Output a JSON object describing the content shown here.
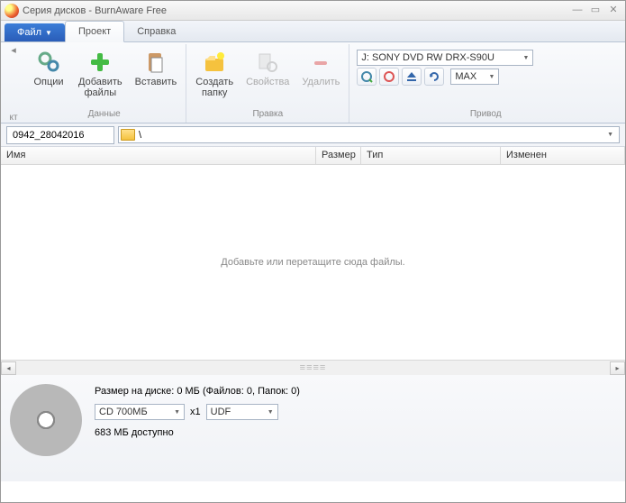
{
  "window": {
    "title": "Серия дисков - BurnAware Free"
  },
  "tabs": {
    "file": "Файл",
    "project": "Проект",
    "help": "Справка"
  },
  "ribbon": {
    "nav_label": "кт",
    "options": "Опции",
    "add_files": "Добавить\nфайлы",
    "paste": "Вставить",
    "create_folder": "Создать\nпапку",
    "properties": "Свойства",
    "delete": "Удалить",
    "group_data": "Данные",
    "group_edit": "Правка",
    "group_drive": "Привод",
    "drive": "J: SONY DVD RW DRX-S90U",
    "speed": "MAX"
  },
  "path": {
    "disc_name": "0942_28042016",
    "current": "\\"
  },
  "columns": {
    "name": "Имя",
    "size": "Размер",
    "type": "Тип",
    "modified": "Изменен"
  },
  "empty_hint": "Добавьте или перетащите сюда файлы.",
  "status": {
    "summary": "Размер на диске: 0 МБ (Файлов: 0, Папок: 0)",
    "media": "CD 700МБ",
    "mult": "x1",
    "fs": "UDF",
    "free": "683 МБ доступно"
  }
}
